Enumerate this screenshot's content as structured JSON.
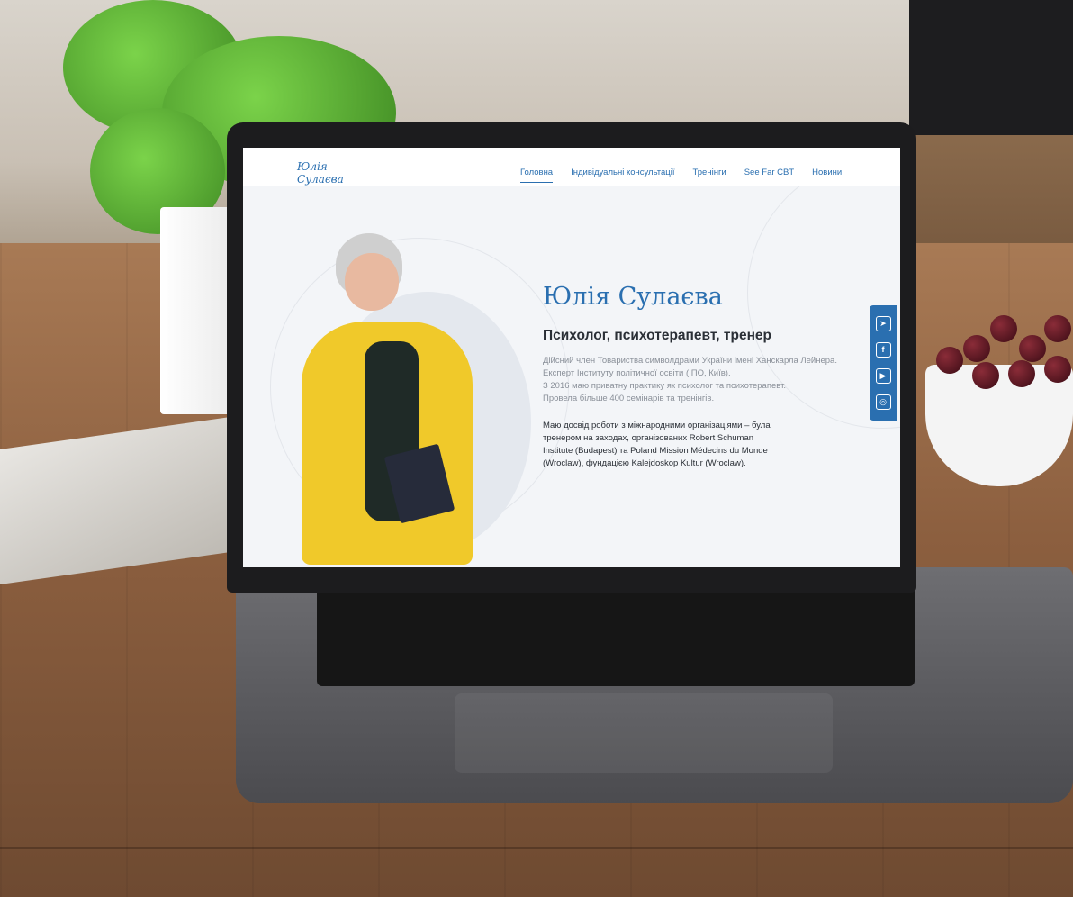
{
  "site": {
    "logo": {
      "line1": "Юлія",
      "line2": "Сулаєва"
    },
    "nav": [
      {
        "label": "Головна",
        "active": true
      },
      {
        "label": "Індивідуальні консультації",
        "active": false
      },
      {
        "label": "Тренінги",
        "active": false
      },
      {
        "label": "See Far CBT",
        "active": false
      },
      {
        "label": "Новини",
        "active": false
      }
    ],
    "hero": {
      "name": "Юлія Сулаєва",
      "subtitle": "Психолог, психотерапевт, тренер",
      "bio": [
        "Дійсний член Товариства символдрами України імені Ханскарла Лейнера.",
        "Експерт Інституту політичної освіти (ІПО, Київ).",
        "З 2016 маю приватну практику як психолог та психотерапевт.",
        "Провела більше 400 семінарів та тренінгів."
      ],
      "experience": [
        "Маю досвід роботи з міжнародними організаціями – була",
        "тренером на заходах, організованих Robert Schuman",
        "Institute (Budapest) та Poland Mission Médecins du Monde",
        "(Wroclaw), фундацією Kalejdoskop Kultur (Wroclaw)."
      ]
    },
    "social": [
      {
        "icon": "telegram-icon",
        "glyph": "➤"
      },
      {
        "icon": "facebook-icon",
        "glyph": "f"
      },
      {
        "icon": "youtube-icon",
        "glyph": "▶"
      },
      {
        "icon": "instagram-icon",
        "glyph": "◎"
      }
    ],
    "colors": {
      "accent": "#2a6fb0",
      "text": "#2a2f36",
      "muted": "#8a9099",
      "jacket": "#f0c92a"
    }
  }
}
